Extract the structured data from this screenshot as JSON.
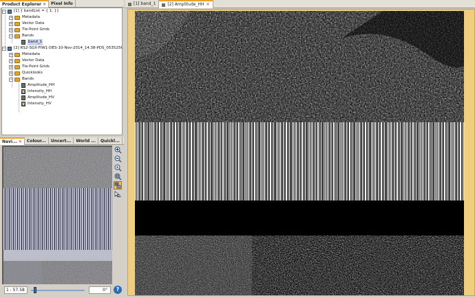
{
  "left_tabs": {
    "product_explorer": "Product Explorer",
    "pixel_info": "Pixel Info"
  },
  "tree": {
    "p1": {
      "title": "[1] { bandList = { 1; }}",
      "children": [
        "Metadata",
        "Vector Data",
        "Tie-Point Grids",
        "Bands"
      ],
      "band": "band_1"
    },
    "p2": {
      "title": "[2] RS2-SGX-FIW1-DES-10-Nov-2014_14.38-PDS_05352560",
      "children": [
        "Metadata",
        "Vector Data",
        "Tie-Point Grids",
        "Quicklooks",
        "Bands"
      ],
      "bands": [
        {
          "label": "Amplitude_HH",
          "type": "band"
        },
        {
          "label": "Intensity_HH",
          "type": "virtual"
        },
        {
          "label": "Amplitude_HV",
          "type": "band"
        },
        {
          "label": "Intensity_HV",
          "type": "virtual"
        }
      ]
    }
  },
  "bottom_tabs": [
    "Navi...",
    "Colour...",
    "Uncert...",
    "World ...",
    "Quickl..."
  ],
  "nav": {
    "zoom": "1 : 57.58",
    "angle": "0°",
    "slider_fraction": 0.08
  },
  "image_tabs": [
    {
      "label": "[1] band_1",
      "active": false
    },
    {
      "label": "[2] Amplitude_HH",
      "active": true
    }
  ],
  "icons": [
    "zoom-in-icon",
    "zoom-out-icon",
    "zoom-actual-icon",
    "zoom-all-icon",
    "sync-views-icon",
    "sync-cursor-icon",
    "help-icon"
  ],
  "colors": {
    "accent": "#e8a32a",
    "help_button": "#2d6ab8"
  }
}
